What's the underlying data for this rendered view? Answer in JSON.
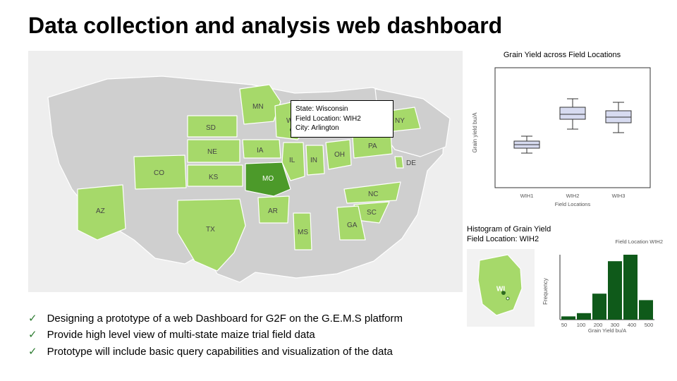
{
  "title": "Data collection and analysis web dashboard",
  "map": {
    "tooltip": {
      "state_line": "State: Wisconsin",
      "field_line": "Field Location: WIH2",
      "city_line": "City: Arlington"
    },
    "labels": {
      "MN": "MN",
      "SD": "SD",
      "WI": "WI",
      "IA": "IA",
      "IL": "IL",
      "IN": "IN",
      "OH": "OH",
      "PA": "PA",
      "NY": "NY",
      "NE": "NE",
      "KS": "KS",
      "CO": "CO",
      "AZ": "AZ",
      "MO": "MO",
      "AR": "AR",
      "TX": "TX",
      "MS": "MS",
      "GA": "GA",
      "SC": "SC",
      "NC": "NC",
      "DE": "DE"
    }
  },
  "boxplot": {
    "title": "Grain Yield across Field Locations",
    "ylabel": "Grain yield bu/A",
    "xlabel": "Field Locations",
    "xticks": [
      "WIH1",
      "WIH2",
      "WIH3"
    ]
  },
  "histogram_panel": {
    "title_line1": "Histogram of Grain Yield",
    "title_line2": "Field Location: WIH2",
    "subcaption": "Field Location WIH2",
    "thumb_label": "WI",
    "xlabel": "Grain Yield bu/A",
    "ylabel": "Frequency",
    "xticks": [
      "50",
      "100",
      "200",
      "300",
      "400",
      "500"
    ]
  },
  "bullets": {
    "items": [
      "Designing a prototype of a web Dashboard for G2F on the G.E.M.S platform",
      "Provide high level view of multi-state maize trial field data",
      "Prototype will include basic query capabilities and visualization of the data"
    ],
    "check": "✓"
  },
  "chart_data": [
    {
      "type": "box",
      "title": "Grain Yield across Field Locations",
      "xlabel": "Field Locations",
      "ylabel": "Grain yield bu/A",
      "categories": [
        "WIH1",
        "WIH2",
        "WIH3"
      ],
      "ylim": [
        0,
        350
      ],
      "series": [
        {
          "name": "WIH1",
          "min": 100,
          "q1": 115,
          "median": 125,
          "q3": 135,
          "max": 150
        },
        {
          "name": "WIH2",
          "min": 170,
          "q1": 200,
          "median": 215,
          "q3": 235,
          "max": 260
        },
        {
          "name": "WIH3",
          "min": 160,
          "q1": 190,
          "median": 205,
          "q3": 225,
          "max": 250
        }
      ]
    },
    {
      "type": "bar",
      "title": "Histogram of Grain Yield — Field Location WIH2",
      "xlabel": "Grain Yield bu/A",
      "ylabel": "Frequency",
      "ylim": [
        0,
        200
      ],
      "categories": [
        "50",
        "100",
        "200",
        "300",
        "400",
        "500"
      ],
      "values": [
        10,
        20,
        80,
        180,
        200,
        60
      ]
    }
  ]
}
